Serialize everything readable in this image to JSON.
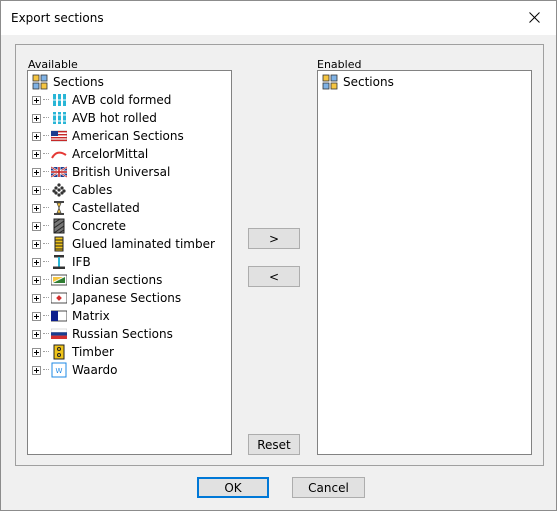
{
  "window": {
    "title": "Export sections"
  },
  "available": {
    "label": "Available",
    "root": "Sections",
    "items": [
      {
        "label": "AVB cold formed",
        "icon": "avb-cold-icon"
      },
      {
        "label": "AVB hot rolled",
        "icon": "avb-hot-icon"
      },
      {
        "label": "American Sections",
        "icon": "us-flag-icon"
      },
      {
        "label": "ArcelorMittal",
        "icon": "arcelormittal-icon"
      },
      {
        "label": "British Universal",
        "icon": "uk-flag-icon"
      },
      {
        "label": "Cables",
        "icon": "cable-icon"
      },
      {
        "label": "Castellated",
        "icon": "castellated-icon"
      },
      {
        "label": "Concrete",
        "icon": "concrete-icon"
      },
      {
        "label": "Glued laminated timber",
        "icon": "glulam-icon"
      },
      {
        "label": "IFB",
        "icon": "ifb-icon"
      },
      {
        "label": "Indian sections",
        "icon": "india-flag-icon"
      },
      {
        "label": "Japanese Sections",
        "icon": "japan-flag-icon"
      },
      {
        "label": "Matrix",
        "icon": "matrix-icon"
      },
      {
        "label": "Russian Sections",
        "icon": "russia-flag-icon"
      },
      {
        "label": "Timber",
        "icon": "timber-icon"
      },
      {
        "label": "Waardo",
        "icon": "waardo-icon"
      }
    ]
  },
  "enabled": {
    "label": "Enabled",
    "root": "Sections"
  },
  "buttons": {
    "add": ">",
    "remove": "<",
    "reset": "Reset",
    "ok": "OK",
    "cancel": "Cancel"
  }
}
